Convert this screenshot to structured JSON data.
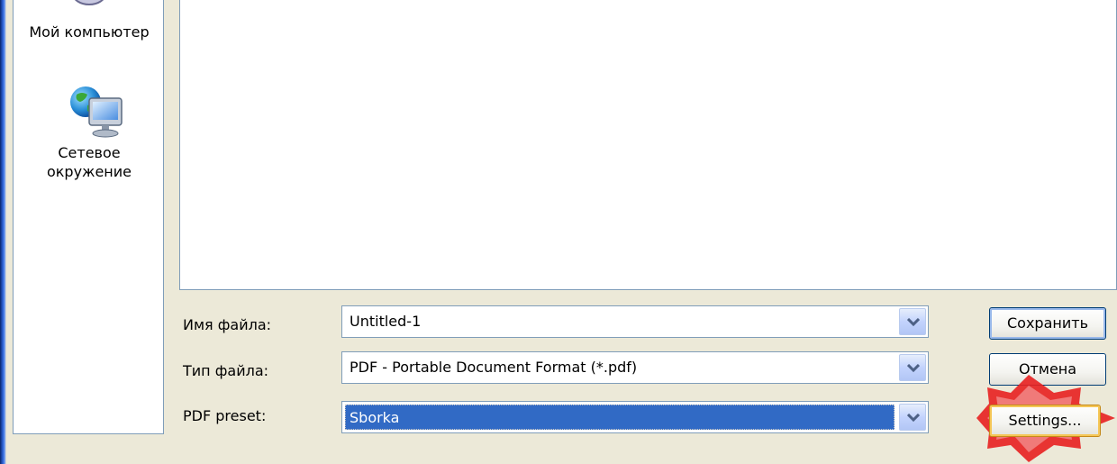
{
  "places": [
    {
      "label": "Мой компьютер",
      "icon": "my-computer-icon"
    },
    {
      "label_line1": "Сетевое",
      "label_line2": "окружение",
      "icon": "network-places-icon"
    }
  ],
  "fields": {
    "filename": {
      "label": "Имя файла:",
      "value": "Untitled-1"
    },
    "filetype": {
      "label": "Тип файла:",
      "value": "PDF - Portable Document Format (*.pdf)"
    },
    "preset": {
      "label": "PDF preset:",
      "value": "Sborka"
    }
  },
  "buttons": {
    "save": "Сохранить",
    "cancel": "Отмена",
    "settings": "Settings..."
  },
  "colors": {
    "selection": "#316ac5",
    "highlight_marker": "#e82020",
    "dialog_bg": "#ece9d8"
  }
}
